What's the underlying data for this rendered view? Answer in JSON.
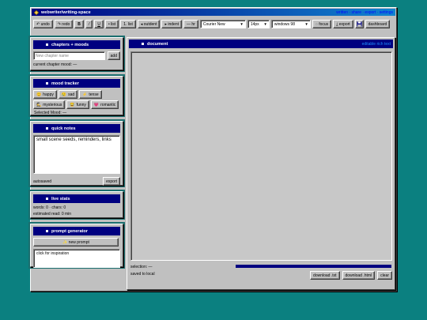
{
  "window": {
    "title": "webwriter/writing-space",
    "links": "written · share · export · settings"
  },
  "toolbar": {
    "undo": "↶ undo",
    "redo": "↷ redo",
    "bold": "B",
    "italic": "/",
    "underline": "U",
    "bullet_list": "• list",
    "numbered_list": "1. list",
    "outdent": "◂ outdent",
    "indent": "▸ indent",
    "hr": "— hr",
    "font": "Courier New",
    "size": "14px",
    "theme": "windows 98",
    "focus": "◌ focus",
    "export": "⤓ export",
    "save_icon": "floppy-disk",
    "dashboard": "dashboard",
    "progress": 0.19
  },
  "chapters": {
    "header": "chapters + moods",
    "placeholder": "New chapter name",
    "add": "add",
    "current_mood": "current chapter mood: —"
  },
  "mood_tracker": {
    "header": "mood tracker",
    "moods": [
      {
        "emoji": "😊",
        "label": "happy"
      },
      {
        "emoji": "😢",
        "label": "sad"
      },
      {
        "emoji": "⚡",
        "label": "tense"
      },
      {
        "emoji": "🕵",
        "label": "mysterious"
      },
      {
        "emoji": "😂",
        "label": "funny"
      },
      {
        "emoji": "💗",
        "label": "romantic"
      }
    ],
    "selected": "Selected Mood: —"
  },
  "quick_notes": {
    "header": "quick notes",
    "text": "small scene seeds, reminders, links",
    "status": "autosaved",
    "export": "export"
  },
  "live_stats": {
    "header": "live stats",
    "counts": "words: 0 · chars: 0",
    "read": "estimated read: 0 min"
  },
  "prompt_generator": {
    "header": "prompt generator",
    "button": "✨ new prompt",
    "output": "click for inspiration"
  },
  "document": {
    "header": "document",
    "header_right": "editable rich text",
    "selection": "selection: —",
    "save_status": "saved to local",
    "download_txt": "download .txt",
    "download_html": "download .html",
    "clear": "clear"
  }
}
